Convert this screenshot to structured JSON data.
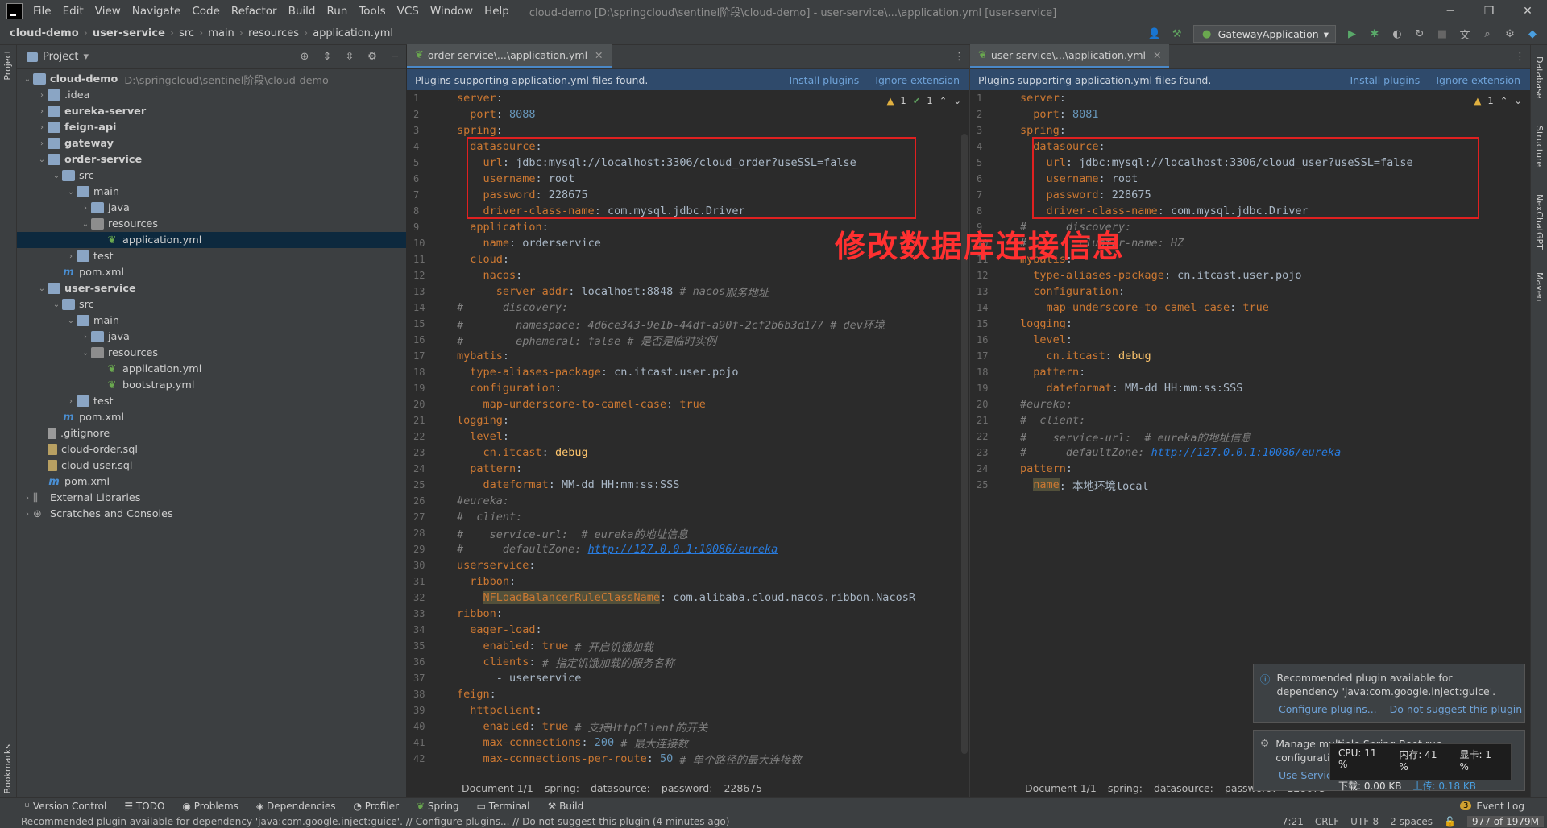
{
  "menu": [
    "File",
    "Edit",
    "View",
    "Navigate",
    "Code",
    "Refactor",
    "Build",
    "Run",
    "Tools",
    "VCS",
    "Window",
    "Help"
  ],
  "window_title": "cloud-demo [D:\\springcloud\\sentinel阶段\\cloud-demo] - user-service\\...\\application.yml [user-service]",
  "breadcrumb": [
    "cloud-demo",
    "user-service",
    "src",
    "main",
    "resources",
    "application.yml"
  ],
  "run_config": "GatewayApplication",
  "project_panel": {
    "title": "Project",
    "tree": [
      {
        "label": "cloud-demo",
        "path": "D:\\springcloud\\sentinel阶段\\cloud-demo",
        "indent": 0,
        "icon": "folder-module",
        "open": true,
        "bold": true
      },
      {
        "label": ".idea",
        "indent": 1,
        "icon": "folder",
        "open": false
      },
      {
        "label": "eureka-server",
        "indent": 1,
        "icon": "folder-module",
        "open": false,
        "bold": true
      },
      {
        "label": "feign-api",
        "indent": 1,
        "icon": "folder-module",
        "open": false,
        "bold": true
      },
      {
        "label": "gateway",
        "indent": 1,
        "icon": "folder-module",
        "open": false,
        "bold": true
      },
      {
        "label": "order-service",
        "indent": 1,
        "icon": "folder-module",
        "open": true,
        "bold": true
      },
      {
        "label": "src",
        "indent": 2,
        "icon": "folder",
        "open": true
      },
      {
        "label": "main",
        "indent": 3,
        "icon": "folder",
        "open": true
      },
      {
        "label": "java",
        "indent": 4,
        "icon": "folder-src",
        "open": false
      },
      {
        "label": "resources",
        "indent": 4,
        "icon": "folder-res",
        "open": true
      },
      {
        "label": "application.yml",
        "indent": 5,
        "icon": "yml",
        "leaf": true,
        "selected": true
      },
      {
        "label": "test",
        "indent": 3,
        "icon": "folder",
        "open": false
      },
      {
        "label": "pom.xml",
        "indent": 2,
        "icon": "maven",
        "leaf": true
      },
      {
        "label": "user-service",
        "indent": 1,
        "icon": "folder-module",
        "open": true,
        "bold": true
      },
      {
        "label": "src",
        "indent": 2,
        "icon": "folder",
        "open": true
      },
      {
        "label": "main",
        "indent": 3,
        "icon": "folder",
        "open": true
      },
      {
        "label": "java",
        "indent": 4,
        "icon": "folder-src",
        "open": false
      },
      {
        "label": "resources",
        "indent": 4,
        "icon": "folder-res",
        "open": true
      },
      {
        "label": "application.yml",
        "indent": 5,
        "icon": "yml",
        "leaf": true
      },
      {
        "label": "bootstrap.yml",
        "indent": 5,
        "icon": "yml",
        "leaf": true
      },
      {
        "label": "test",
        "indent": 3,
        "icon": "folder",
        "open": false
      },
      {
        "label": "pom.xml",
        "indent": 2,
        "icon": "maven",
        "leaf": true
      },
      {
        "label": ".gitignore",
        "indent": 1,
        "icon": "git",
        "leaf": true
      },
      {
        "label": "cloud-order.sql",
        "indent": 1,
        "icon": "sql",
        "leaf": true
      },
      {
        "label": "cloud-user.sql",
        "indent": 1,
        "icon": "sql",
        "leaf": true
      },
      {
        "label": "pom.xml",
        "indent": 1,
        "icon": "maven",
        "leaf": true
      },
      {
        "label": "External Libraries",
        "indent": 0,
        "icon": "libs",
        "open": false
      },
      {
        "label": "Scratches and Consoles",
        "indent": 0,
        "icon": "scratch",
        "open": false
      }
    ]
  },
  "left_editor": {
    "tab": "order-service\\...\\application.yml",
    "banner": "Plugins supporting application.yml files found.",
    "install": "Install plugins",
    "ignore": "Ignore extension",
    "inspections": {
      "warnings": "1",
      "ok": "1"
    },
    "lines": [
      [
        [
          "k",
          "server"
        ],
        [
          "v",
          ":"
        ]
      ],
      [
        [
          "v",
          "  "
        ],
        [
          "k",
          "port"
        ],
        [
          "v",
          ": "
        ],
        [
          "n",
          "8088"
        ]
      ],
      [
        [
          "k",
          "spring"
        ],
        [
          "v",
          ":"
        ]
      ],
      [
        [
          "v",
          "  "
        ],
        [
          "k",
          "datasource"
        ],
        [
          "v",
          ":"
        ]
      ],
      [
        [
          "v",
          "    "
        ],
        [
          "k",
          "url"
        ],
        [
          "v",
          ": jdbc:mysql://localhost:3306/cloud_order?useSSL=false"
        ]
      ],
      [
        [
          "v",
          "    "
        ],
        [
          "k",
          "username"
        ],
        [
          "v",
          ": root"
        ]
      ],
      [
        [
          "v",
          "    "
        ],
        [
          "k",
          "password"
        ],
        [
          "v",
          ": 228675"
        ]
      ],
      [
        [
          "v",
          "    "
        ],
        [
          "k",
          "driver-class-name"
        ],
        [
          "v",
          ": com.mysql.jdbc.Driver"
        ]
      ],
      [
        [
          "v",
          "  "
        ],
        [
          "k",
          "application"
        ],
        [
          "v",
          ":"
        ]
      ],
      [
        [
          "v",
          "    "
        ],
        [
          "k",
          "name"
        ],
        [
          "v",
          ": orderservice"
        ]
      ],
      [
        [
          "v",
          "  "
        ],
        [
          "k",
          "cloud"
        ],
        [
          "v",
          ":"
        ]
      ],
      [
        [
          "v",
          "    "
        ],
        [
          "k",
          "nacos"
        ],
        [
          "v",
          ":"
        ]
      ],
      [
        [
          "v",
          "      "
        ],
        [
          "k",
          "server-addr"
        ],
        [
          "v",
          ": localhost:8848 "
        ],
        [
          "c",
          "# "
        ],
        [
          "cu",
          "nacos"
        ],
        [
          "c",
          "服务地址"
        ]
      ],
      [
        [
          "c",
          "#      discovery:"
        ]
      ],
      [
        [
          "c",
          "#        namespace: 4d6ce343-9e1b-44df-a90f-2cf2b6b3d177 # dev环境"
        ]
      ],
      [
        [
          "c",
          "#        ephemeral: false # 是否是临时实例"
        ]
      ],
      [
        [
          "k",
          "mybatis"
        ],
        [
          "v",
          ":"
        ]
      ],
      [
        [
          "v",
          "  "
        ],
        [
          "k",
          "type-aliases-package"
        ],
        [
          "v",
          ": cn.itcast.user.pojo"
        ]
      ],
      [
        [
          "v",
          "  "
        ],
        [
          "k",
          "configuration"
        ],
        [
          "v",
          ":"
        ]
      ],
      [
        [
          "v",
          "    "
        ],
        [
          "k",
          "map-underscore-to-camel-case"
        ],
        [
          "v",
          ": "
        ],
        [
          "k",
          "true"
        ]
      ],
      [
        [
          "k",
          "logging"
        ],
        [
          "v",
          ":"
        ]
      ],
      [
        [
          "v",
          "  "
        ],
        [
          "k",
          "level"
        ],
        [
          "v",
          ":"
        ]
      ],
      [
        [
          "v",
          "    "
        ],
        [
          "k",
          "cn.itcast"
        ],
        [
          "v",
          ": "
        ],
        [
          "b",
          "debug"
        ]
      ],
      [
        [
          "v",
          "  "
        ],
        [
          "k",
          "pattern"
        ],
        [
          "v",
          ":"
        ]
      ],
      [
        [
          "v",
          "    "
        ],
        [
          "k",
          "dateformat"
        ],
        [
          "v",
          ": MM-dd HH:mm:ss:SSS"
        ]
      ],
      [
        [
          "c",
          "#eureka:"
        ]
      ],
      [
        [
          "c",
          "#  client:"
        ]
      ],
      [
        [
          "c",
          "#    service-url:  # eureka的地址信息"
        ]
      ],
      [
        [
          "c",
          "#      defaultZone: "
        ],
        [
          "u",
          "http://127.0.0.1:10086/eureka"
        ]
      ],
      [
        [
          "k",
          "userservice"
        ],
        [
          "v",
          ":"
        ]
      ],
      [
        [
          "v",
          "  "
        ],
        [
          "k",
          "ribbon"
        ],
        [
          "v",
          ":"
        ]
      ],
      [
        [
          "v",
          "    "
        ],
        [
          "hl",
          "NFLoadBalancerRuleClassName"
        ],
        [
          "v",
          ": com.alibaba.cloud.nacos.ribbon.NacosR"
        ]
      ],
      [
        [
          "k",
          "ribbon"
        ],
        [
          "v",
          ":"
        ]
      ],
      [
        [
          "v",
          "  "
        ],
        [
          "k",
          "eager-load"
        ],
        [
          "v",
          ":"
        ]
      ],
      [
        [
          "v",
          "    "
        ],
        [
          "k",
          "enabled"
        ],
        [
          "v",
          ": "
        ],
        [
          "k",
          "true"
        ],
        [
          "c",
          " # 开启饥饿加载"
        ]
      ],
      [
        [
          "v",
          "    "
        ],
        [
          "k",
          "clients"
        ],
        [
          "v",
          ": "
        ],
        [
          "c",
          "# 指定饥饿加载的服务名称"
        ]
      ],
      [
        [
          "v",
          "      - userservice"
        ]
      ],
      [
        [
          "k",
          "feign"
        ],
        [
          "v",
          ":"
        ]
      ],
      [
        [
          "v",
          "  "
        ],
        [
          "k",
          "httpclient"
        ],
        [
          "v",
          ":"
        ]
      ],
      [
        [
          "v",
          "    "
        ],
        [
          "k",
          "enabled"
        ],
        [
          "v",
          ": "
        ],
        [
          "k",
          "true"
        ],
        [
          "c",
          " # 支持HttpClient的开关"
        ]
      ],
      [
        [
          "v",
          "    "
        ],
        [
          "k",
          "max-connections"
        ],
        [
          "v",
          ": "
        ],
        [
          "n",
          "200"
        ],
        [
          "c",
          " # 最大连接数"
        ]
      ],
      [
        [
          "v",
          "    "
        ],
        [
          "k",
          "max-connections-per-route"
        ],
        [
          "v",
          ": "
        ],
        [
          "n",
          "50"
        ],
        [
          "c",
          " # 单个路径的最大连接数"
        ]
      ]
    ],
    "crumbs": [
      "Document 1/1",
      "spring:",
      "datasource:",
      "password:",
      "228675"
    ]
  },
  "right_editor": {
    "tab": "user-service\\...\\application.yml",
    "banner": "Plugins supporting application.yml files found.",
    "install": "Install plugins",
    "ignore": "Ignore extension",
    "inspections": {
      "warnings": "1"
    },
    "lines": [
      [
        [
          "k",
          "server"
        ],
        [
          "v",
          ":"
        ]
      ],
      [
        [
          "v",
          "  "
        ],
        [
          "k",
          "port"
        ],
        [
          "v",
          ": "
        ],
        [
          "n",
          "8081"
        ]
      ],
      [
        [
          "k",
          "spring"
        ],
        [
          "v",
          ":"
        ]
      ],
      [
        [
          "v",
          "  "
        ],
        [
          "k",
          "datasource"
        ],
        [
          "v",
          ":"
        ]
      ],
      [
        [
          "v",
          "    "
        ],
        [
          "k",
          "url"
        ],
        [
          "v",
          ": jdbc:mysql://localhost:3306/cloud_user?useSSL=false"
        ]
      ],
      [
        [
          "v",
          "    "
        ],
        [
          "k",
          "username"
        ],
        [
          "v",
          ": root"
        ]
      ],
      [
        [
          "v",
          "    "
        ],
        [
          "k",
          "password"
        ],
        [
          "v",
          ": 228675"
        ]
      ],
      [
        [
          "v",
          "    "
        ],
        [
          "k",
          "driver-class-name"
        ],
        [
          "v",
          ": com.mysql.jdbc.Driver"
        ]
      ],
      [
        [
          "c",
          "#      discovery:"
        ]
      ],
      [
        [
          "c",
          "#        cluster-name: HZ"
        ]
      ],
      [
        [
          "k",
          "mybatis"
        ],
        [
          "v",
          ":"
        ]
      ],
      [
        [
          "v",
          "  "
        ],
        [
          "k",
          "type-aliases-package"
        ],
        [
          "v",
          ": cn.itcast.user.pojo"
        ]
      ],
      [
        [
          "v",
          "  "
        ],
        [
          "k",
          "configuration"
        ],
        [
          "v",
          ":"
        ]
      ],
      [
        [
          "v",
          "    "
        ],
        [
          "k",
          "map-underscore-to-camel-case"
        ],
        [
          "v",
          ": "
        ],
        [
          "k",
          "true"
        ]
      ],
      [
        [
          "k",
          "logging"
        ],
        [
          "v",
          ":"
        ]
      ],
      [
        [
          "v",
          "  "
        ],
        [
          "k",
          "level"
        ],
        [
          "v",
          ":"
        ]
      ],
      [
        [
          "v",
          "    "
        ],
        [
          "k",
          "cn.itcast"
        ],
        [
          "v",
          ": "
        ],
        [
          "b",
          "debug"
        ]
      ],
      [
        [
          "v",
          "  "
        ],
        [
          "k",
          "pattern"
        ],
        [
          "v",
          ":"
        ]
      ],
      [
        [
          "v",
          "    "
        ],
        [
          "k",
          "dateformat"
        ],
        [
          "v",
          ": MM-dd HH:mm:ss:SSS"
        ]
      ],
      [
        [
          "c",
          "#eureka:"
        ]
      ],
      [
        [
          "c",
          "#  client:"
        ]
      ],
      [
        [
          "c",
          "#    service-url:  # eureka的地址信息"
        ]
      ],
      [
        [
          "c",
          "#      defaultZone: "
        ],
        [
          "u",
          "http://127.0.0.1:10086/eureka"
        ]
      ],
      [
        [
          "k",
          "pattern"
        ],
        [
          "v",
          ":"
        ]
      ],
      [
        [
          "v",
          "  "
        ],
        [
          "hl",
          "name"
        ],
        [
          "v",
          ": 本地环境local"
        ]
      ]
    ],
    "crumbs": [
      "Document 1/1",
      "spring:",
      "datasource:",
      "password:",
      "228675"
    ]
  },
  "annotation_text": "修改数据库连接信息",
  "bottom_tools": [
    "Version Control",
    "TODO",
    "Problems",
    "Dependencies",
    "Profiler",
    "Spring",
    "Terminal",
    "Build"
  ],
  "event_log": {
    "count": "3",
    "label": "Event Log"
  },
  "status": {
    "message": "Recommended plugin available for dependency 'java:com.google.inject:guice'. // Configure plugins... // Do not suggest this plugin (4 minutes ago)",
    "position": "7:21",
    "line_sep": "CRLF",
    "encoding": "UTF-8",
    "indent": "2 spaces",
    "memory": "977 of 1979M"
  },
  "notification1": {
    "text": "Recommended plugin available for dependency 'java:com.google.inject:guice'.",
    "link1": "Configure plugins...",
    "link2": "Do not suggest this plugin"
  },
  "notification2": {
    "line1": "Manage multiple Spring Boot run",
    "line2": "configurati",
    "link": "Use Servic"
  },
  "net_widget": {
    "cpu": "CPU: 11 %",
    "mem": "内存: 41 %",
    "gpu": "显卡: 1 %",
    "down": "下载: 0.00 KB",
    "up": "上传: 0.18 KB"
  },
  "side_tools": {
    "left": [
      "Project",
      "Bookmarks"
    ],
    "right": [
      "Database",
      "Structure",
      "NexChatGPT",
      "Maven"
    ]
  }
}
